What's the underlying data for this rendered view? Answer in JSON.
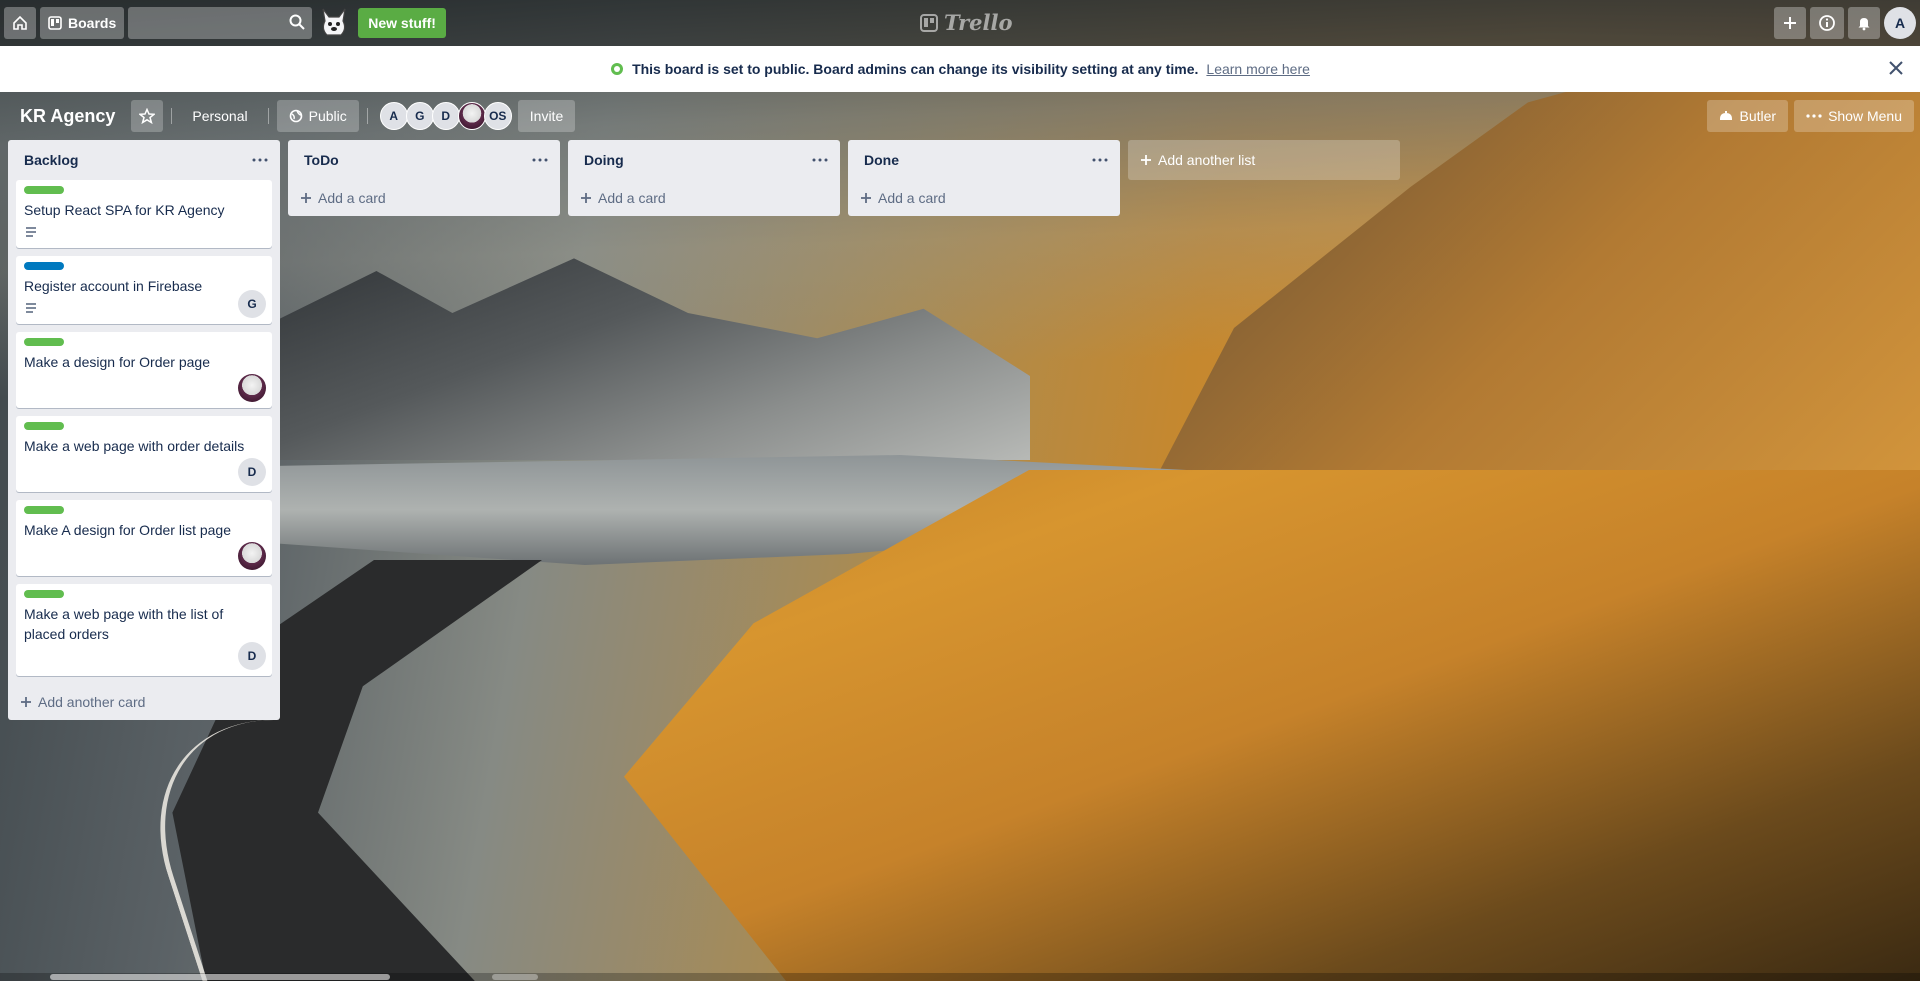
{
  "header": {
    "boards_label": "Boards",
    "new_stuff_label": "New stuff!",
    "logo_text": "Trello",
    "user_initial": "A"
  },
  "banner": {
    "message": "This board is set to public. Board admins can change its visibility setting at any time.",
    "learn_more": "Learn more here"
  },
  "board": {
    "title": "KR Agency",
    "team_label": "Personal",
    "visibility_label": "Public",
    "members": [
      {
        "initials": "A"
      },
      {
        "initials": "G"
      },
      {
        "initials": "D"
      },
      {
        "initials": ""
      },
      {
        "initials": "OS"
      }
    ],
    "invite_label": "Invite",
    "butler_label": "Butler",
    "show_menu_label": "Show Menu"
  },
  "lists": [
    {
      "title": "Backlog",
      "add_label": "Add another card",
      "cards": [
        {
          "title": "Setup React SPA for KR Agency",
          "label_color": "#61bd4f",
          "has_description": true,
          "member": null
        },
        {
          "title": "Register account in Firebase",
          "label_color": "#0079bf",
          "has_description": true,
          "member": "G"
        },
        {
          "title": "Make a design for Order page",
          "label_color": "#61bd4f",
          "has_description": false,
          "member": "photo"
        },
        {
          "title": "Make a web page with order details",
          "label_color": "#61bd4f",
          "has_description": false,
          "member": "D"
        },
        {
          "title": "Make A design for Order list page",
          "label_color": "#61bd4f",
          "has_description": false,
          "member": "photo"
        },
        {
          "title": "Make a web page with the list of placed orders",
          "label_color": "#61bd4f",
          "has_description": false,
          "member": "D"
        }
      ]
    },
    {
      "title": "ToDo",
      "add_label": "Add a card",
      "cards": []
    },
    {
      "title": "Doing",
      "add_label": "Add a card",
      "cards": []
    },
    {
      "title": "Done",
      "add_label": "Add a card",
      "cards": []
    }
  ],
  "add_list_label": "Add another list",
  "colors": {
    "label_green": "#61bd4f",
    "label_blue": "#0079bf",
    "new_stuff_green": "#5aac44",
    "list_bg": "#ebecf0"
  }
}
